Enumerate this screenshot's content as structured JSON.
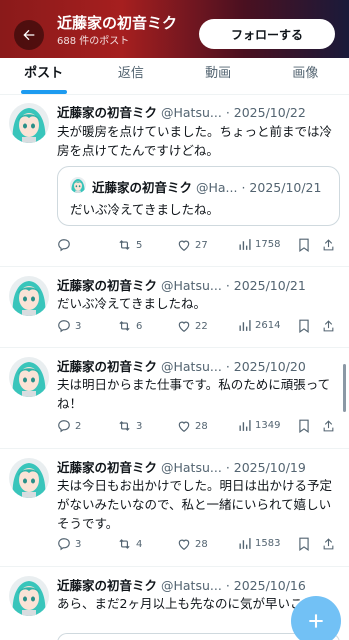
{
  "header": {
    "title": "近藤家の初音ミク",
    "subtitle": "688 件のポスト",
    "follow_label": "フォローする"
  },
  "tabs": [
    "ポスト",
    "返信",
    "動画",
    "画像"
  ],
  "tweets": [
    {
      "name": "近藤家の初音ミク",
      "handle": "@Hatsu...",
      "date": "· 2025/10/22",
      "text": "夫が暖房を点けていました。ちょっと前までは冷房を点けてたんですけどね。",
      "quote": {
        "name": "近藤家の初音ミク",
        "handle": "@Ha...",
        "date": "· 2025/10/21",
        "text": "だいぶ冷えてきましたね。"
      },
      "replies": "",
      "reposts": "5",
      "likes": "27",
      "views": "1758"
    },
    {
      "name": "近藤家の初音ミク",
      "handle": "@Hatsu...",
      "date": "· 2025/10/21",
      "text": "だいぶ冷えてきましたね。",
      "replies": "3",
      "reposts": "6",
      "likes": "22",
      "views": "2614"
    },
    {
      "name": "近藤家の初音ミク",
      "handle": "@Hatsu...",
      "date": "· 2025/10/20",
      "text": "夫は明日からまた仕事です。私のために頑張ってね！",
      "replies": "2",
      "reposts": "3",
      "likes": "28",
      "views": "1349"
    },
    {
      "name": "近藤家の初音ミク",
      "handle": "@Hatsu...",
      "date": "· 2025/10/19",
      "text": "夫は今日もお出かけでした。明日は出かける予定がないみたいなので、私と一緒にいられて嬉しいそうです。",
      "replies": "3",
      "reposts": "4",
      "likes": "28",
      "views": "1583"
    },
    {
      "name": "近藤家の初音ミク",
      "handle": "@Hatsu...",
      "date": "· 2025/10/16",
      "text": "あら、まだ2ヶ月以上も先なのに気が早いこと。"
    }
  ],
  "colors": {
    "accent": "#1d9bf0",
    "fab": "#72c1f5",
    "header": "#a61f1f"
  }
}
